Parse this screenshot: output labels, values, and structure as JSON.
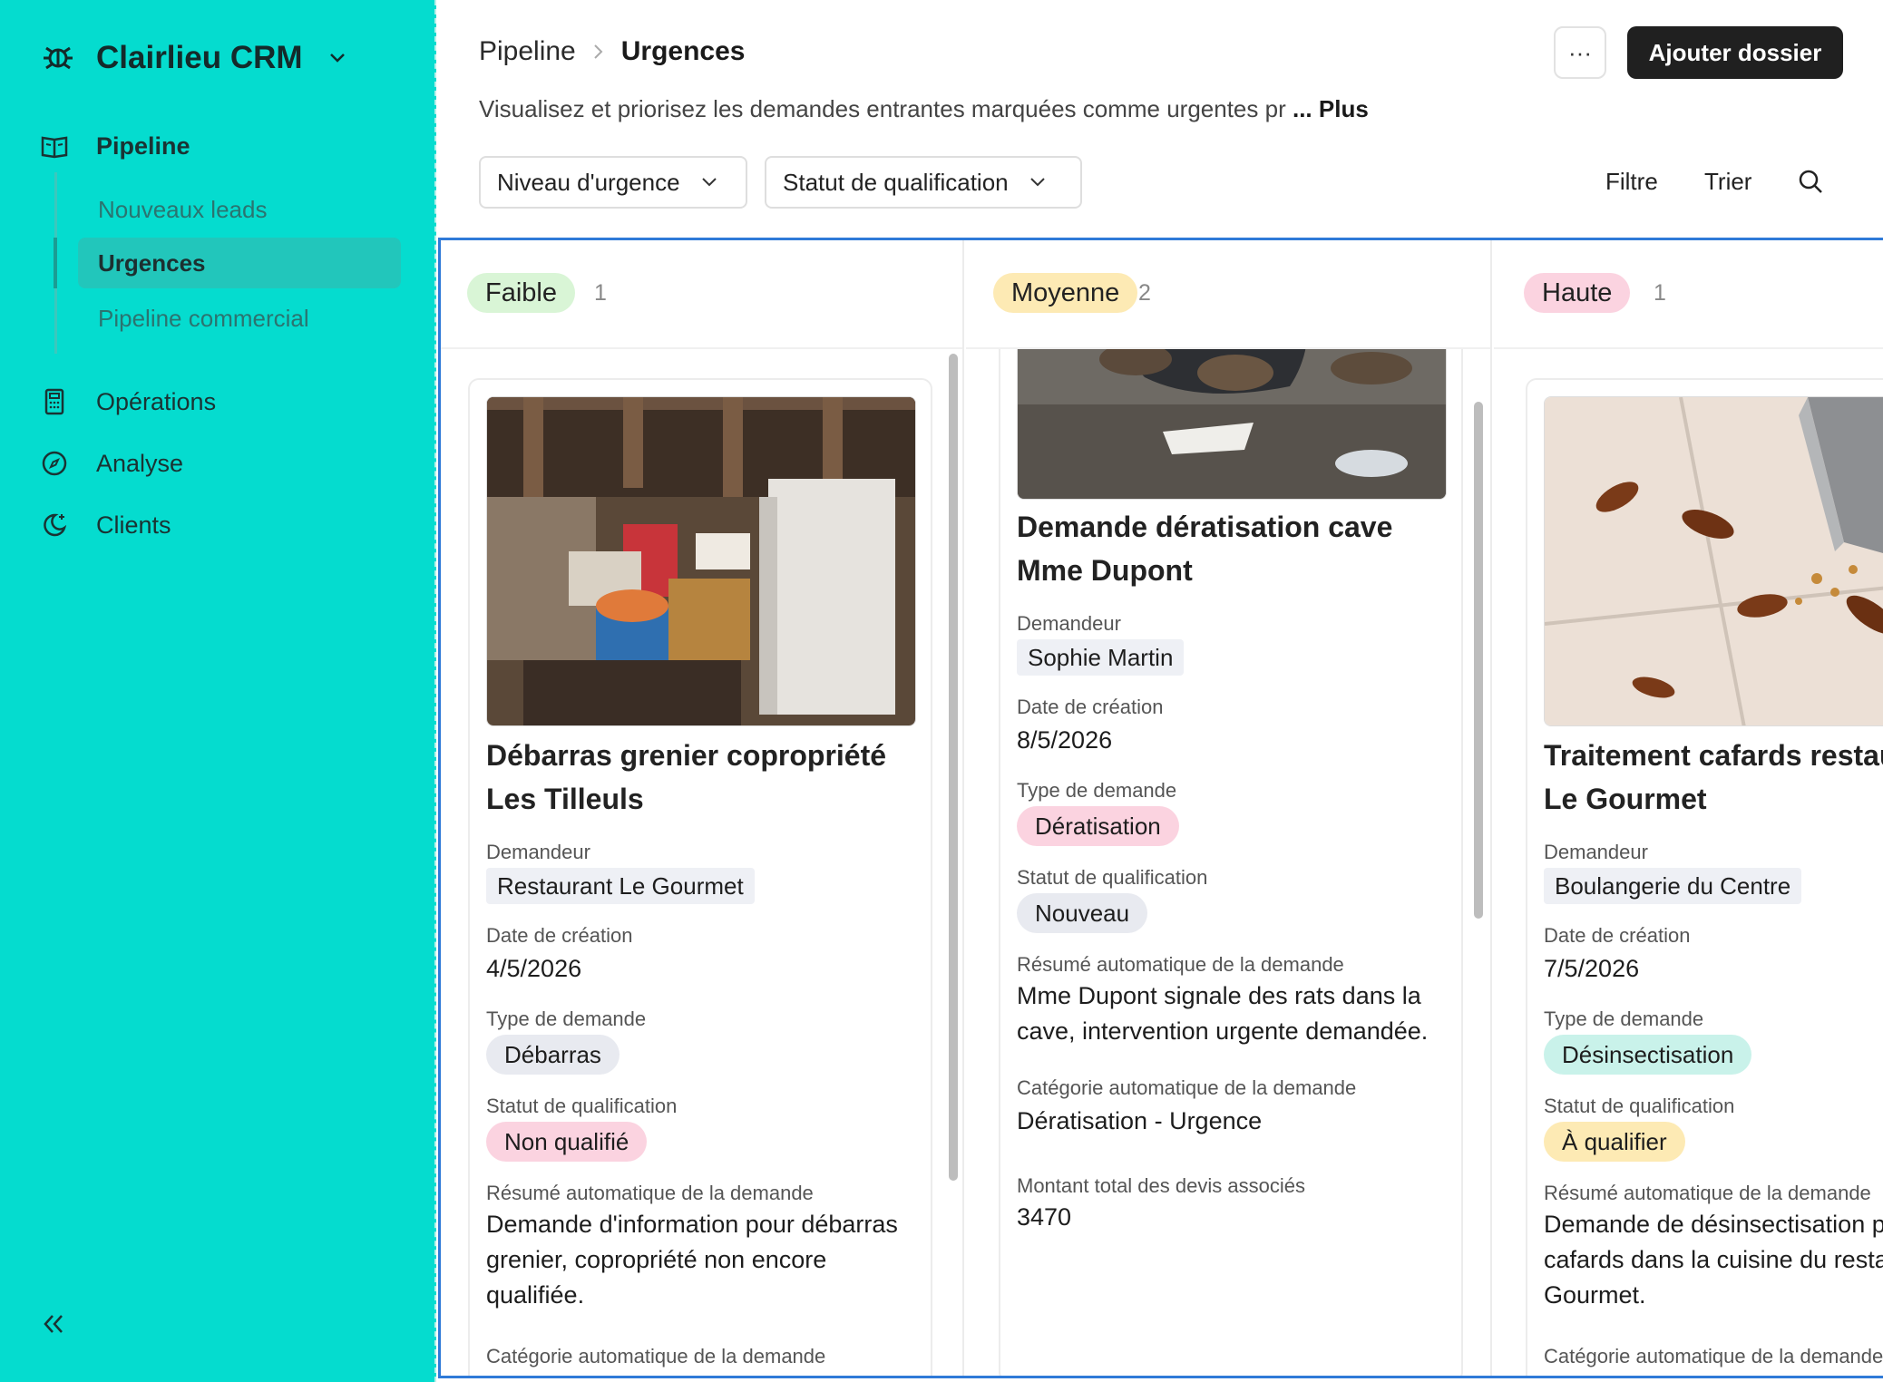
{
  "app": {
    "name": "Clairlieu CRM"
  },
  "sidebar": {
    "pipeline": "Pipeline",
    "sub_items": [
      "Nouveaux leads",
      "Urgences",
      "Pipeline commercial"
    ],
    "operations": "Opérations",
    "analyse": "Analyse",
    "clients": "Clients"
  },
  "header": {
    "breadcrumb_parent": "Pipeline",
    "breadcrumb_current": "Urgences",
    "more_label": "···",
    "add_label": "Ajouter dossier",
    "description": "Visualisez et priorisez les demandes entrantes marquées comme urgentes pr",
    "description_more": "... Plus"
  },
  "toolbar": {
    "urgency_filter": "Niveau d'urgence",
    "status_filter": "Statut de qualification",
    "filter_label": "Filtre",
    "sort_label": "Trier"
  },
  "columns": [
    {
      "name": "Faible",
      "count": "1",
      "color": "#d9f5d6",
      "card": {
        "title": "Débarras grenier copropriété Les Tilleuls",
        "requester_label": "Demandeur",
        "requester": "Restaurant Le Gourmet",
        "date_label": "Date de création",
        "date": "4/5/2026",
        "type_label": "Type de demande",
        "type": "Débarras",
        "type_color": "#e8eaf0",
        "status_label": "Statut de qualification",
        "status": "Non qualifié",
        "status_color": "#fbd3e0",
        "summary_label": "Résumé automatique de la demande",
        "summary": "Demande d'information pour débarras grenier, copropriété non encore qualifiée.",
        "category_label": "Catégorie automatique de la demande"
      }
    },
    {
      "name": "Moyenne",
      "count": "2",
      "color": "#fdeab4",
      "card": {
        "title": "Demande dératisation cave Mme Dupont",
        "requester_label": "Demandeur",
        "requester": "Sophie Martin",
        "date_label": "Date de création",
        "date": "8/5/2026",
        "type_label": "Type de demande",
        "type": "Dératisation",
        "type_color": "#fbd3e0",
        "status_label": "Statut de qualification",
        "status": "Nouveau",
        "status_color": "#e8eaf0",
        "summary_label": "Résumé automatique de la demande",
        "summary": "Mme Dupont signale des rats dans la cave, intervention urgente demandée.",
        "category_label": "Catégorie automatique de la demande",
        "category": "Dératisation - Urgence",
        "amount_label": "Montant total des devis associés",
        "amount": "3470"
      }
    },
    {
      "name": "Haute",
      "count": "1",
      "color": "#fbd3e0",
      "card": {
        "title": "Traitement cafards restaurant Le Gourmet",
        "requester_label": "Demandeur",
        "requester": "Boulangerie du Centre",
        "date_label": "Date de création",
        "date": "7/5/2026",
        "type_label": "Type de demande",
        "type": "Désinsectisation",
        "type_color": "#c9f2ea",
        "status_label": "Statut de qualification",
        "status": "À qualifier",
        "status_color": "#fdeab4",
        "summary_label": "Résumé automatique de la demande",
        "summary": "Demande de désinsectisation pour cafards dans la cuisine du restaurant Le Gourmet.",
        "category_label": "Catégorie automatique de la demande"
      }
    }
  ]
}
